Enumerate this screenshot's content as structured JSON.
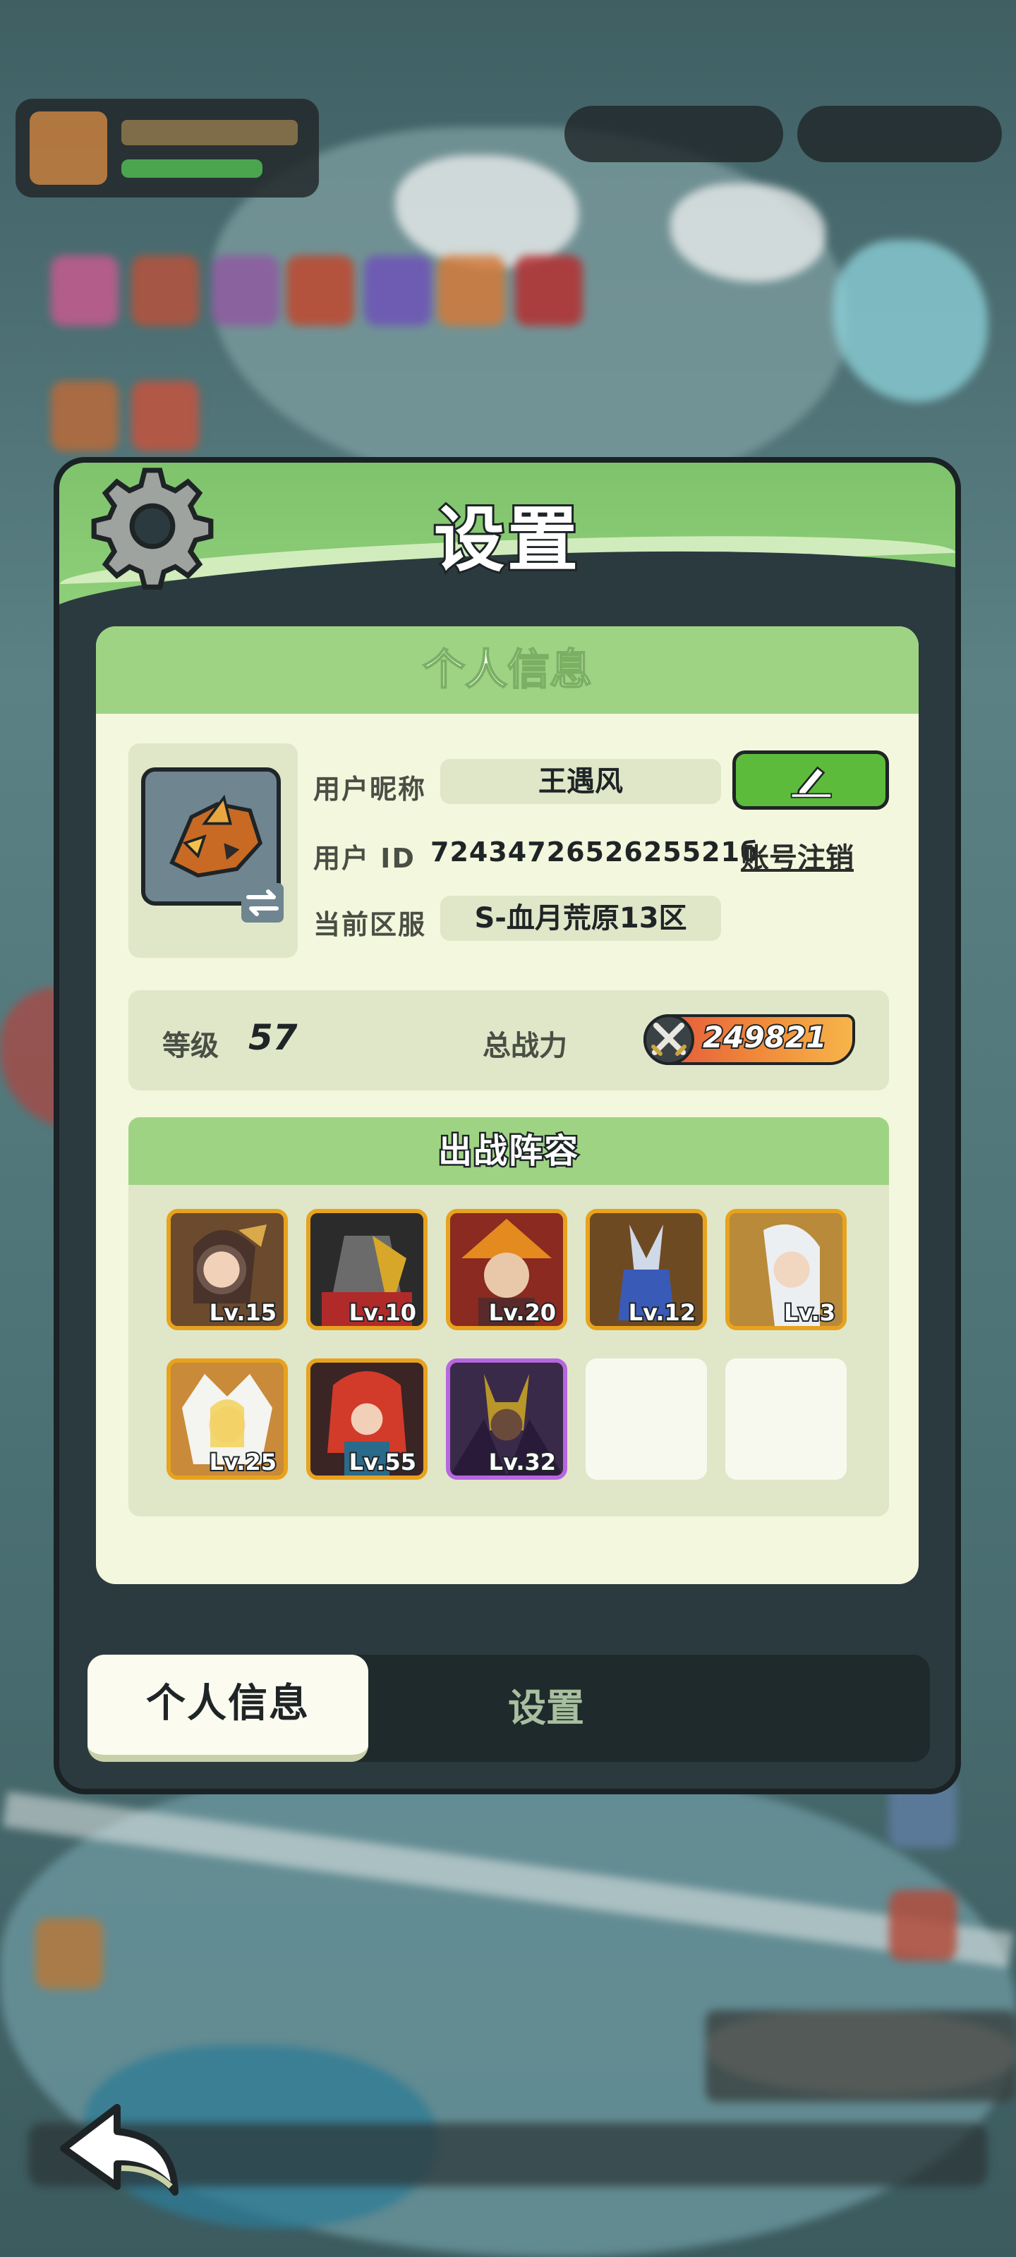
{
  "dialog": {
    "title": "设置"
  },
  "personal_info": {
    "header": "个人信息",
    "nickname_label": "用户昵称",
    "nickname": "王遇风",
    "user_id_label": "用户 ID",
    "user_id": "7243472652625521б",
    "logout_label": "账号注销",
    "server_label": "当前区服",
    "server": "S-血月荒原13区",
    "level_label": "等级",
    "level": "57",
    "power_label": "总战力",
    "power": "249821"
  },
  "lineup": {
    "header": "出战阵容",
    "heroes": [
      {
        "level": "Lv.15",
        "frame": "gold"
      },
      {
        "level": "Lv.10",
        "frame": "gold"
      },
      {
        "level": "Lv.20",
        "frame": "gold"
      },
      {
        "level": "Lv.12",
        "frame": "gold"
      },
      {
        "level": "Lv.3",
        "frame": "gold"
      },
      {
        "level": "Lv.25",
        "frame": "gold"
      },
      {
        "level": "Lv.55",
        "frame": "gold"
      },
      {
        "level": "Lv.32",
        "frame": "purple"
      }
    ]
  },
  "tabs": {
    "active": "个人信息",
    "inactive": "设置"
  },
  "colors": {
    "header_green": "#8fcf79",
    "card_bg": "#f3f7dd",
    "gold_frame": "#e7a21e",
    "purple_frame": "#b766e0",
    "edit_button": "#5dbb3c"
  }
}
